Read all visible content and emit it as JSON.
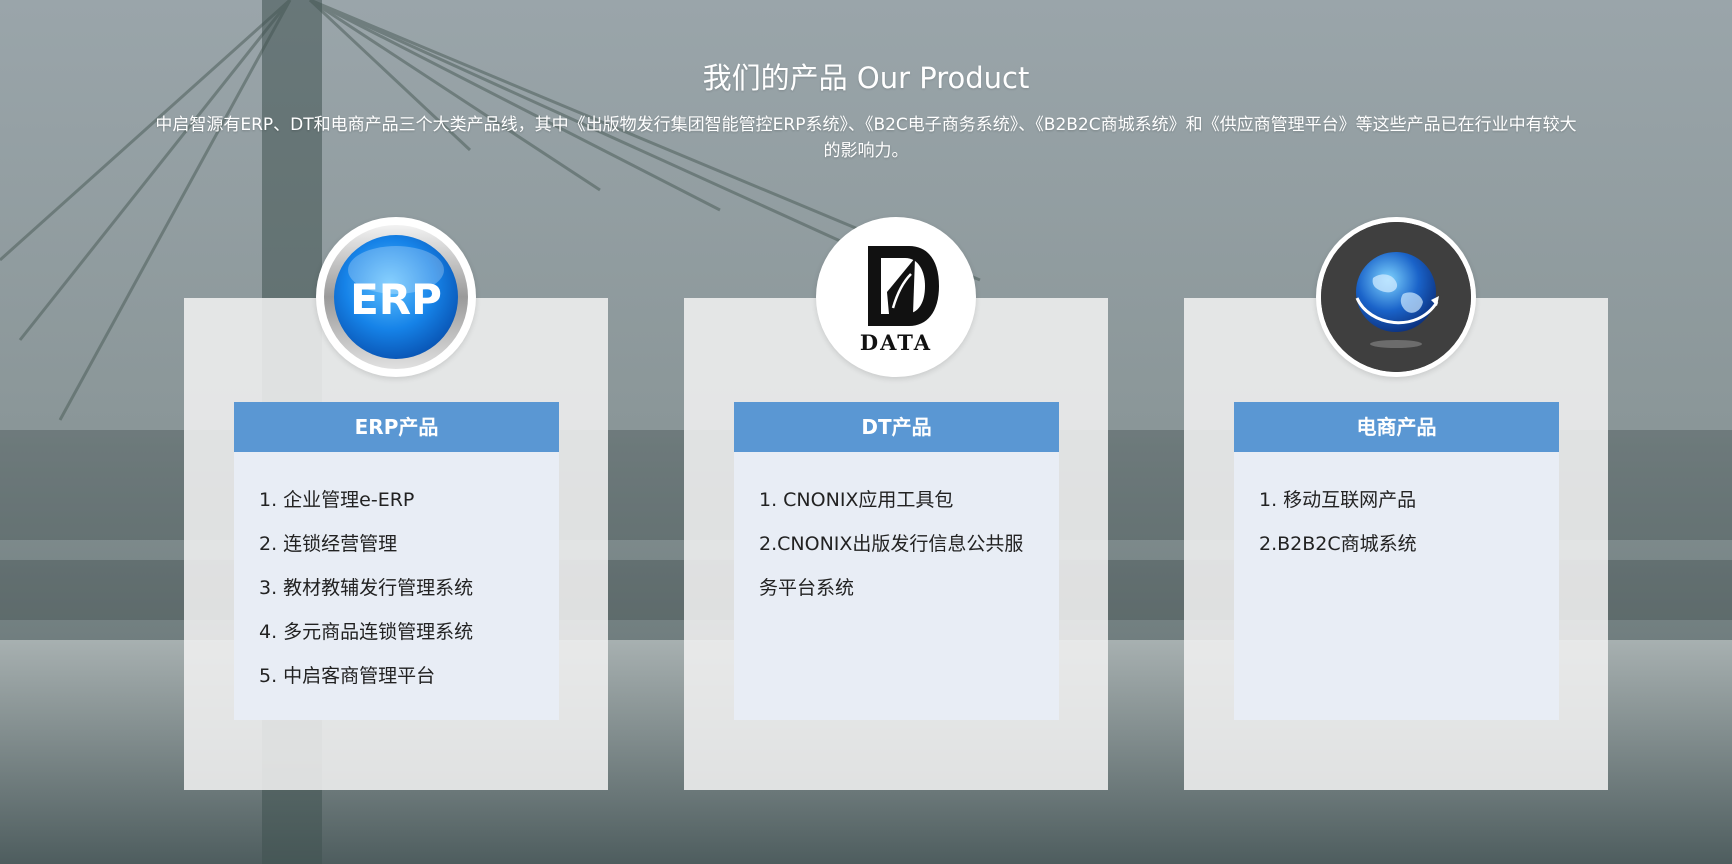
{
  "header": {
    "title": "我们的产品 Our Product",
    "subtitle": "中启智源有ERP、DT和电商产品三个大类产品线，其中《出版物发行集团智能管控ERP系统》、《B2C电子商务系统》、《B2B2C商城系统》和《供应商管理平台》等这些产品已在行业中有较大的影响力。"
  },
  "products": [
    {
      "logo": "erp-logo",
      "logo_text": "ERP",
      "title": "ERP产品",
      "items": [
        "1. 企业管理e-ERP",
        "2. 连锁经营管理",
        "3. 教材教辅发行管理系统",
        "4. 多元商品连锁管理系统",
        "5. 中启客商管理平台"
      ]
    },
    {
      "logo": "data-logo",
      "logo_text": "DATA",
      "title": "DT产品",
      "items": [
        "1. CNONIX应用工具包",
        "2.CNONIX出版发行信息公共服务平台系统"
      ]
    },
    {
      "logo": "globe-logo",
      "title": "电商产品",
      "items": [
        "1. 移动互联网产品",
        "2.B2B2C商城系统"
      ]
    }
  ],
  "colors": {
    "panel_header": "#5a97d3",
    "panel_body": "#e8edf5",
    "card_bg": "#f0f0f0"
  }
}
